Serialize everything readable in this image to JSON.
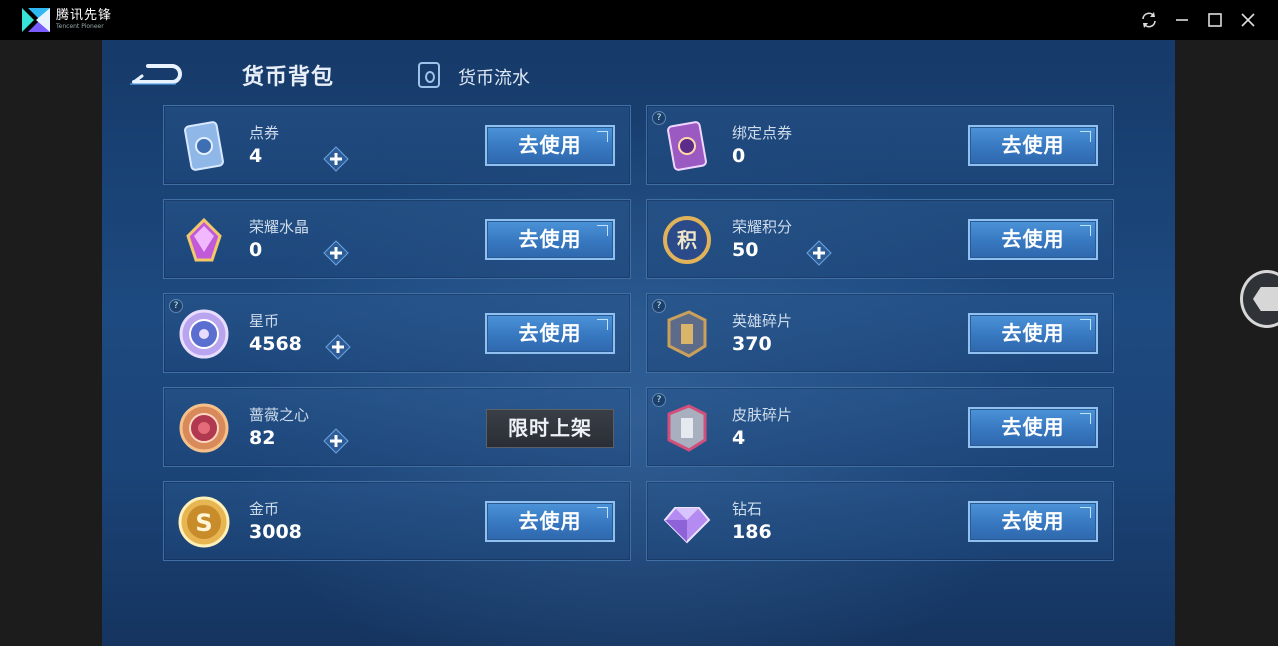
{
  "app": {
    "title": "腾讯先锋",
    "subtitle": "Tencent Pioneer"
  },
  "tabs": {
    "active": "货币背包",
    "flow": "货币流水"
  },
  "actions": {
    "use": "去使用",
    "limited": "限时上架"
  },
  "currencies": [
    {
      "name": "点券",
      "value": "4",
      "icon": "coupon-card-icon",
      "has_plus": true,
      "help": false,
      "action": "use"
    },
    {
      "name": "绑定点券",
      "value": "0",
      "icon": "bound-coupon-card-icon",
      "has_plus": false,
      "help": true,
      "action": "use"
    },
    {
      "name": "荣耀水晶",
      "value": "0",
      "icon": "glory-crystal-icon",
      "has_plus": true,
      "help": false,
      "action": "use"
    },
    {
      "name": "荣耀积分",
      "value": "50",
      "icon": "glory-points-icon",
      "has_plus": true,
      "help": false,
      "action": "use"
    },
    {
      "name": "星币",
      "value": "4568",
      "icon": "star-coin-icon",
      "has_plus": true,
      "help": true,
      "action": "use"
    },
    {
      "name": "英雄碎片",
      "value": "370",
      "icon": "hero-fragment-icon",
      "has_plus": false,
      "help": true,
      "action": "use"
    },
    {
      "name": "蔷薇之心",
      "value": "82",
      "icon": "rose-heart-icon",
      "has_plus": true,
      "help": false,
      "action": "limited"
    },
    {
      "name": "皮肤碎片",
      "value": "4",
      "icon": "skin-fragment-icon",
      "has_plus": false,
      "help": true,
      "action": "use"
    },
    {
      "name": "金币",
      "value": "3008",
      "icon": "gold-coin-icon",
      "has_plus": false,
      "help": false,
      "action": "use"
    },
    {
      "name": "钻石",
      "value": "186",
      "icon": "diamond-icon",
      "has_plus": false,
      "help": false,
      "action": "use"
    }
  ],
  "colors": {
    "background": "#1d4a80",
    "button": "#3778c0",
    "card_border": "#3f6fa5"
  }
}
